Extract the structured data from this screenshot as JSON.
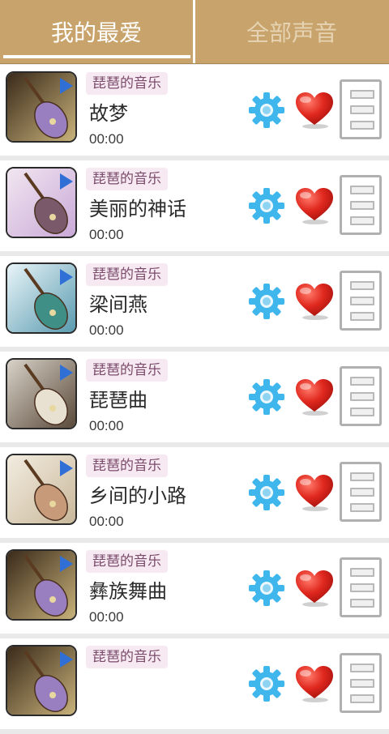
{
  "tabs": {
    "favorites": "我的最爱",
    "all_sounds": "全部声音"
  },
  "items": [
    {
      "tag": "琵琶的音乐",
      "title": "故梦",
      "duration": "00:00"
    },
    {
      "tag": "琵琶的音乐",
      "title": "美丽的神话",
      "duration": "00:00"
    },
    {
      "tag": "琵琶的音乐",
      "title": "梁间燕",
      "duration": "00:00"
    },
    {
      "tag": "琵琶的音乐",
      "title": "琵琶曲",
      "duration": "00:00"
    },
    {
      "tag": "琵琶的音乐",
      "title": "乡间的小路",
      "duration": "00:00"
    },
    {
      "tag": "琵琶的音乐",
      "title": "彝族舞曲",
      "duration": "00:00"
    },
    {
      "tag": "琵琶的音乐",
      "title": "",
      "duration": ""
    }
  ],
  "colors": {
    "header": "#c8a46c",
    "gear": "#3fb6ec",
    "heart": "#d9201a",
    "play": "#2f6fd6"
  }
}
